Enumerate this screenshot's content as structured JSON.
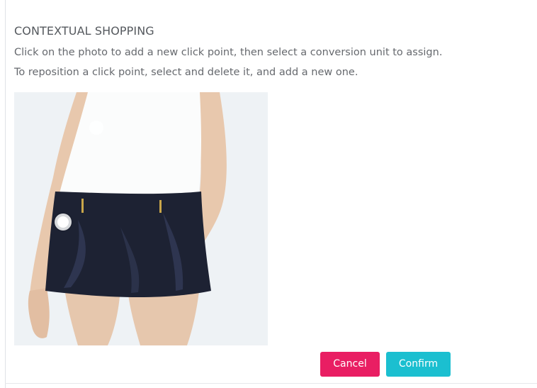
{
  "dialog": {
    "title": "CONTEXTUAL SHOPPING",
    "instruction_1": "Click on the photo to add a new click point, then select a conversion unit to assign.",
    "instruction_2": "To reposition a click point, select and delete it, and add a new one."
  },
  "buttons": {
    "cancel_label": "Cancel",
    "confirm_label": "Confirm"
  },
  "colors": {
    "cancel": "#e91e63",
    "confirm": "#1bbfd0"
  }
}
